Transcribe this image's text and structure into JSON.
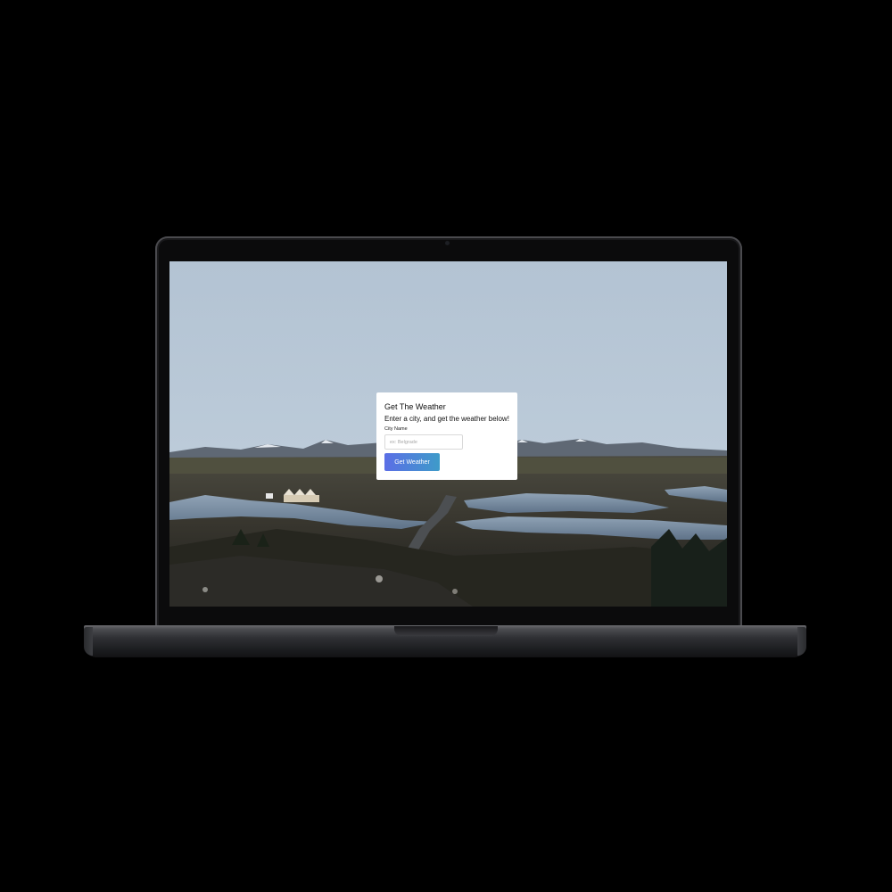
{
  "card": {
    "title": "Get The Weather",
    "subtitle": "Enter a city, and get the weather below!",
    "city_label": "City Name",
    "city_value": "",
    "city_placeholder": "ex: Belgrade",
    "button_label": "Get Weather"
  },
  "colors": {
    "button_gradient_start": "#5b6ee6",
    "button_gradient_end": "#3e9bc9",
    "card_background": "#ffffff"
  }
}
